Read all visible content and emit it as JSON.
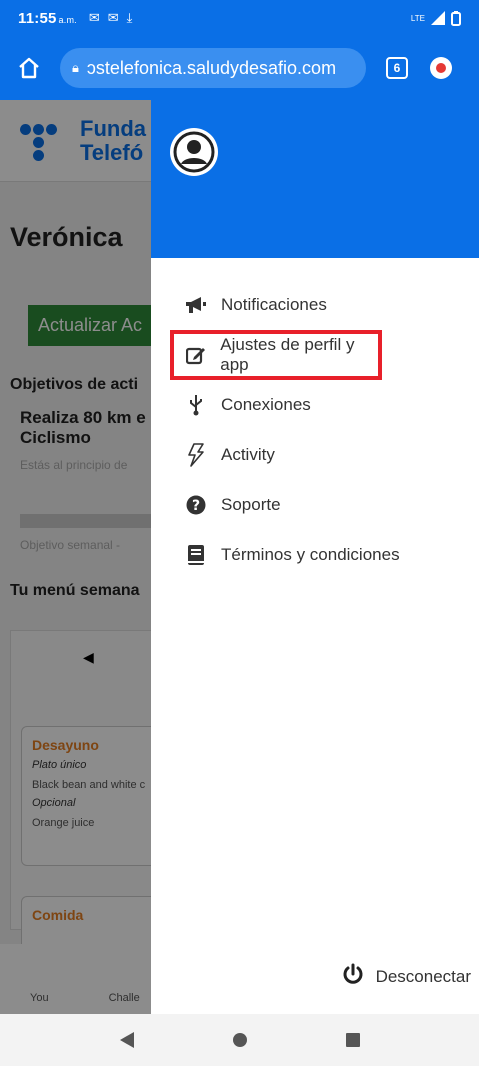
{
  "status_bar": {
    "time": "11:55",
    "ampm": "a.m.",
    "signal_label": "LTE"
  },
  "browser": {
    "url": "ɔstelefonica.saludydesafio.com",
    "tab_count": "6"
  },
  "background_page": {
    "logo_line1": "Funda",
    "logo_line2": "Telefó",
    "user_name": "Verónica",
    "update_button": "Actualizar Ac",
    "objectives_title": "Objetivos de acti",
    "goal_title": "Realiza 80 km e",
    "goal_sub": "Ciclismo",
    "goal_progress": "Estás al principio de",
    "weekly_goal": "Objetivo semanal -",
    "menu_title": "Tu menú semana",
    "meal_1_title": "Desayuno",
    "meal_1_label": "Plato único",
    "meal_1_item": "Black bean and white c",
    "meal_1_optional": "Opcional",
    "meal_1_optional_item": "Orange juice",
    "meal_2_title": "Comida",
    "nav_you": "You",
    "nav_chall": "Challe"
  },
  "drawer": {
    "items": [
      {
        "label": "Notificaciones",
        "icon": "megaphone-icon"
      },
      {
        "label": "Ajustes de perfil y app",
        "icon": "edit-icon"
      },
      {
        "label": "Conexiones",
        "icon": "usb-icon"
      },
      {
        "label": "Activity",
        "icon": "lightning-icon"
      },
      {
        "label": "Soporte",
        "icon": "question-icon"
      },
      {
        "label": "Términos y condiciones",
        "icon": "book-icon"
      }
    ],
    "logout_label": "Desconectar"
  },
  "colors": {
    "primary": "#0a6fe6",
    "highlight": "#e8202a",
    "button_green": "#2f8a3a",
    "meal_orange": "#e67e22"
  }
}
